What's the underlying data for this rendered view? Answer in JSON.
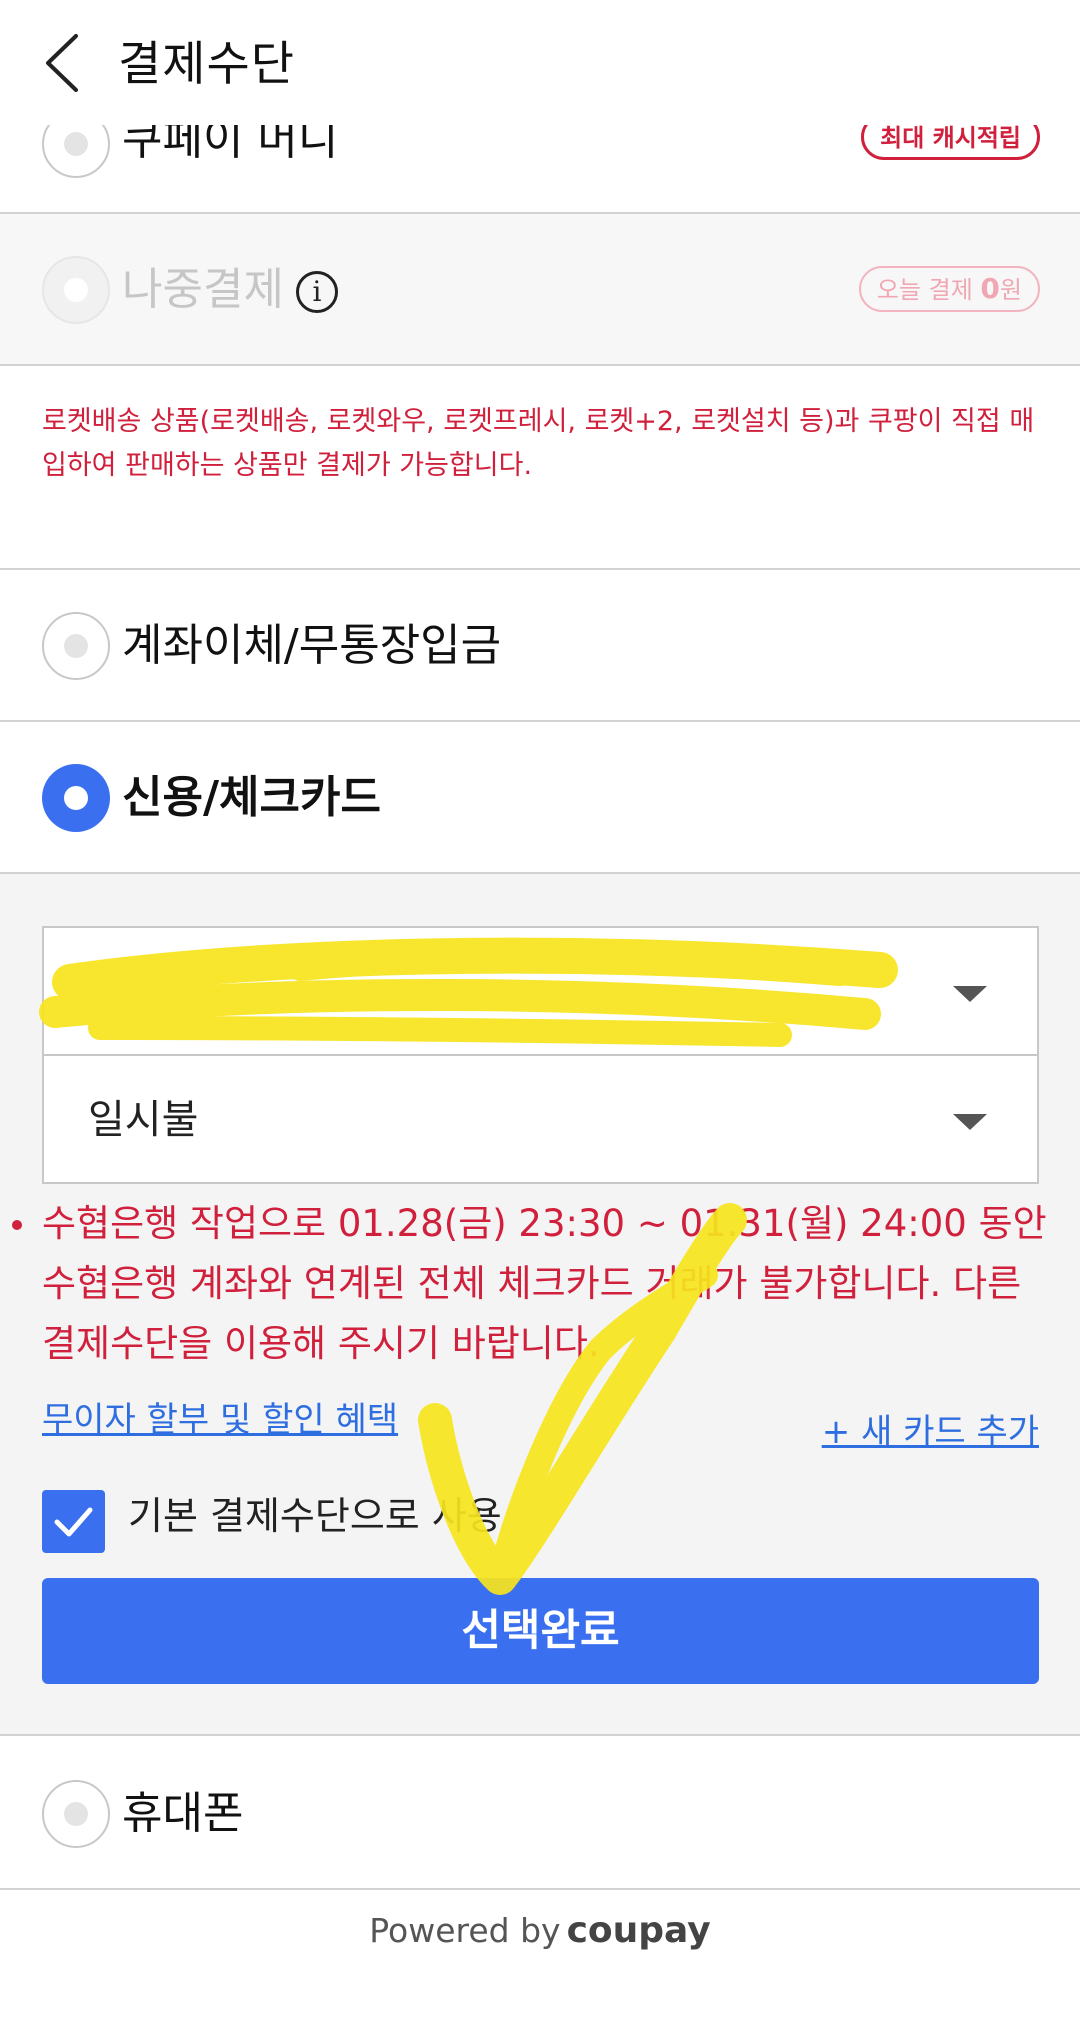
{
  "header": {
    "title": "결제수단"
  },
  "options": {
    "coupay_money": {
      "label": "쿠페이 머니",
      "badge": "최대 캐시적립"
    },
    "pay_later": {
      "label": "나중결제",
      "info_glyph": "i",
      "badge_prefix": "오늘 결제 ",
      "badge_amount": "0",
      "badge_suffix": "원"
    },
    "pay_later_notice": "로켓배송 상품(로켓배송, 로켓와우, 로켓프레시, 로켓+2, 로켓설치 등)과 쿠팡이 직접 매입하여 판매하는 상품만 결제가 가능합니다.",
    "bank_transfer": {
      "label": "계좌이체/무통장입금"
    },
    "credit_card": {
      "label": "신용/체크카드",
      "card_select_value": "",
      "installment_value": "일시불",
      "warning": "수협은행 작업으로 01.28(금) 23:30 ~ 01.31(월) 24:00 동안 수협은행 계좌와 연계된 전체 체크카드 거래가 불가합니다. 다른 결제수단을 이용해 주시기 바랍니다.",
      "installment_link": "무이자 할부 및 할인 혜택",
      "add_card_link": "+ 새 카드 추가",
      "default_checkbox_label": "기본 결제수단으로 사용",
      "default_checked": true,
      "confirm_button": "선택완료"
    },
    "mobile": {
      "label": "휴대폰"
    }
  },
  "footer": {
    "powered_by": "Powered by",
    "brand": "coupay"
  },
  "colors": {
    "accent": "#3a6ff0",
    "warning": "#d0203c",
    "link": "#2f6ee0",
    "highlighter": "#f7e51e"
  },
  "icons": {
    "back": "chevron-left-icon",
    "info": "info-icon",
    "dropdown": "caret-down-icon",
    "check": "checkmark-icon"
  }
}
